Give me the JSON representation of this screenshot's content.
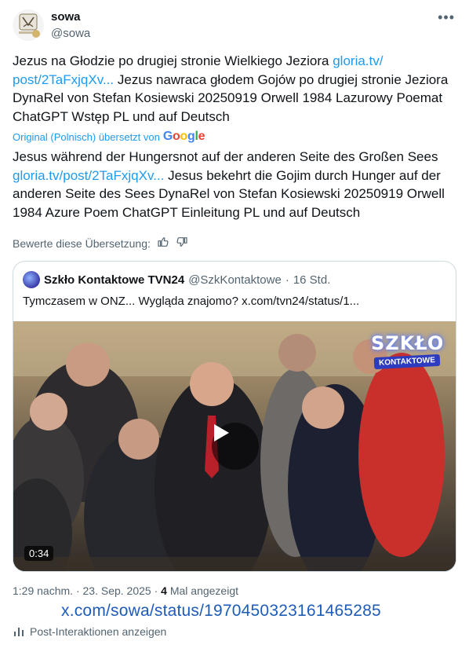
{
  "author": {
    "name": "sowa",
    "handle": "@sowa"
  },
  "tweet": {
    "text_1": "Jezus na Głodzie po drugiej stronie Wielkiego Jeziora ",
    "link_1a": "gloria.tv/",
    "link_1b": "post/2TaFxjqXv...",
    "text_2": " Jezus nawraca głodem Gojów po drugiej stronie Jeziora DynaRel von Stefan  Kosiewski 20250919 Orwell 1984 Lazurowy Poemat ChatGPT Wstęp PL und auf  Deutsch"
  },
  "translation": {
    "label": "Original (Polnisch) übersetzt von",
    "provider_letters": [
      "G",
      "o",
      "o",
      "g",
      "l",
      "e"
    ],
    "text_1": "Jesus während der Hungersnot auf der anderen Seite des Großen Sees ",
    "link": "gloria.tv/post/2TaFxjqXv...",
    "text_2": " Jesus bekehrt die Gojim durch Hunger auf der anderen Seite des Sees DynaRel von Stefan Kosiewski 20250919 Orwell 1984 Azure Poem ChatGPT Einleitung PL und auf Deutsch"
  },
  "rating": {
    "label": "Bewerte diese Übersetzung:"
  },
  "quote": {
    "name": "Szkło Kontaktowe TVN24",
    "handle": "@SzkKontaktowe",
    "separator": "·",
    "time": "16 Std.",
    "text": "Tymczasem w ONZ... Wygląda znajomo?  x.com/tvn24/status/1...",
    "video_duration": "0:34",
    "brand_top": "SZKŁO",
    "brand_bottom": "KONTAKTOWE"
  },
  "meta": {
    "time": "1:29 nachm.",
    "separator": " · ",
    "date": "23. Sep. 2025",
    "views_count": "4",
    "views_label": " Mal angezeigt"
  },
  "url_overlay": "x.com/sowa/status/1970450323161465285",
  "interactions": {
    "label": "Post-Interaktionen anzeigen"
  },
  "colors": {
    "link": "#1d9bf0",
    "secondary_text": "#536471",
    "border": "#cfd9de",
    "url_overlay": "#1f5bb8"
  },
  "icons": [
    "more-icon",
    "thumbs-up-icon",
    "thumbs-down-icon",
    "play-icon",
    "analytics-icon"
  ]
}
